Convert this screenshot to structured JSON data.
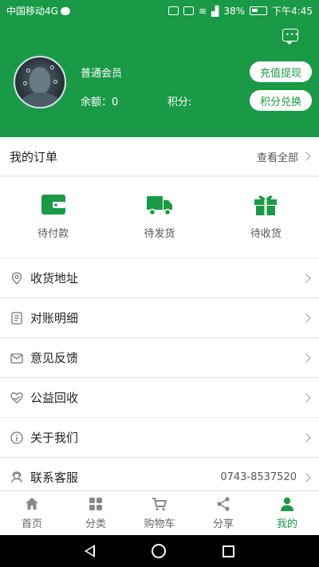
{
  "status_bar": {
    "carrier": "中国移动4G",
    "battery": "38%",
    "time": "下午4:45"
  },
  "header": {
    "member_level": "普通会员",
    "balance_label": "余额：0",
    "points_label": "积分:",
    "recharge_button": "充值提现",
    "exchange_button": "积分兑换"
  },
  "orders": {
    "title": "我的订单",
    "view_all": "查看全部",
    "items": [
      {
        "label": "待付款",
        "icon": "wallet-icon"
      },
      {
        "label": "待发货",
        "icon": "truck-icon"
      },
      {
        "label": "待收货",
        "icon": "gift-icon"
      }
    ]
  },
  "menu": [
    {
      "label": "收货地址",
      "icon": "location-pin-icon"
    },
    {
      "label": "对账明细",
      "icon": "receipt-icon"
    },
    {
      "label": "意见反馈",
      "icon": "envelope-icon"
    },
    {
      "label": "公益回收",
      "icon": "heart-hands-icon"
    },
    {
      "label": "关于我们",
      "icon": "info-icon"
    },
    {
      "label": "联系客服",
      "icon": "headset-icon",
      "extra": "0743-8537520"
    }
  ],
  "tabs": [
    {
      "label": "首页",
      "icon": "home-icon",
      "active": false
    },
    {
      "label": "分类",
      "icon": "grid-icon",
      "active": false
    },
    {
      "label": "购物车",
      "icon": "cart-icon",
      "active": false
    },
    {
      "label": "分享",
      "icon": "share-icon",
      "active": false
    },
    {
      "label": "我的",
      "icon": "user-icon",
      "active": true
    }
  ],
  "colors": {
    "brand_green": "#1a9a46",
    "background": "#f2f2f2"
  }
}
